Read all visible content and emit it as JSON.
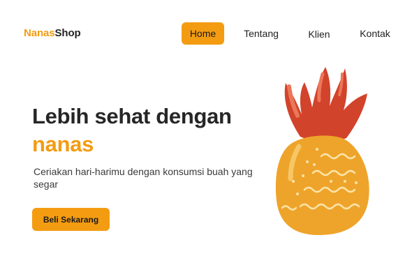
{
  "brand": {
    "part1": "Nanas",
    "part2": "Shop",
    "accent_color": "#f39c12"
  },
  "nav": {
    "items": [
      {
        "label": "Home",
        "active": true
      },
      {
        "label": "Tentang",
        "active": false
      },
      {
        "label": "Klien",
        "active": false
      },
      {
        "label": "Kontak",
        "active": false
      }
    ]
  },
  "hero": {
    "title_line1": "Lebih sehat dengan",
    "title_line2": "nanas",
    "subtitle": "Ceriakan hari-harimu dengan konsumsi buah yang segar",
    "cta_label": "Beli Sekarang"
  },
  "illustration": {
    "icon": "pineapple-icon",
    "crown_color": "#d2432b",
    "body_color": "#eea42a"
  }
}
